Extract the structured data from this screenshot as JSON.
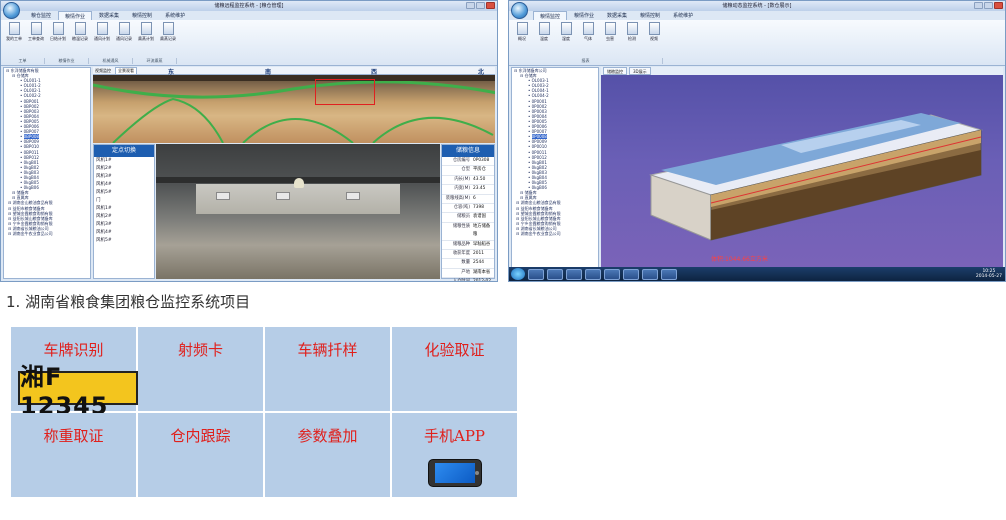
{
  "window1": {
    "title": "储粮远程监控系统 - [粮仓管理]",
    "tabs": [
      "粮仓监控",
      "粮情作业",
      "数据采集",
      "粮情控制",
      "系统维护"
    ],
    "active_tab": 1,
    "ribbon_buttons": [
      "我的工单",
      "工单查询",
      "日结计划",
      "粮温记录",
      "通风计划",
      "通风记录",
      "熏蒸计划",
      "熏蒸记录"
    ],
    "ribbon_groups": [
      "工单",
      "粮情作业",
      "机械通风",
      "环流熏蒸"
    ],
    "tree_items": [
      "东洋储备库有限",
      "仓储库",
      "OL001-1",
      "OL001-2",
      "OL002-1",
      "OL002-2",
      "0BP001",
      "0BP002",
      "0BP003",
      "0BP004",
      "0BP005",
      "0BP006",
      "0BP007",
      "0BP008",
      "0BP009",
      "0BP010",
      "0BP011",
      "0BP012",
      "0kgB01",
      "0kgB02",
      "0kgB03",
      "0kgB04",
      "0kgB05",
      "0kgB06",
      "储备库",
      "直属库",
      "湖南金山粮油食品有限",
      "益阳市粮食储备库",
      "望城金霞粮食购销有限",
      "益阳长城山粮食储备库",
      "宁乡金霞粮食购销有限",
      "湖南省长城粮油公司",
      "湖南金牛农业食品公司"
    ],
    "selected_tree_index": 13,
    "directions": [
      "东",
      "南",
      "西",
      "北"
    ],
    "header_dropdown": "全景观看",
    "side_list_title": "定点切换",
    "side_list": [
      "风机1#",
      "风机2#",
      "风机3#",
      "风机4#",
      "风机5#",
      "门",
      "风机1#",
      "风机2#",
      "风机3#",
      "风机4#",
      "风机5#"
    ],
    "info_title": "储粮信息",
    "info_rows": [
      {
        "k": "仓房编号",
        "v": "0P0308"
      },
      {
        "k": "仓型",
        "v": "平房仓"
      },
      {
        "k": "内长(M)",
        "v": "43.50"
      },
      {
        "k": "内宽(M)",
        "v": "23.45"
      },
      {
        "k": "装粮线高(M)",
        "v": "6"
      },
      {
        "k": "仓容(吨)",
        "v": "7398"
      },
      {
        "k": "储粮员",
        "v": "袁谱国"
      },
      {
        "k": "储粮性质",
        "v": "地方储备粮"
      },
      {
        "k": "储粮品种",
        "v": "早籼稻谷"
      },
      {
        "k": "收获年度",
        "v": "2011"
      },
      {
        "k": "数量",
        "v": "2544"
      },
      {
        "k": "产地",
        "v": "湖南本省"
      },
      {
        "k": "入仓时间",
        "v": "2012-02"
      },
      {
        "k": "保管方式",
        "v": "散装"
      }
    ]
  },
  "window2": {
    "title": "储粮动态监控系统 - [数仓展示]",
    "tabs": [
      "粮情监控",
      "粮情作业",
      "数据采集",
      "粮情控制",
      "系统维护"
    ],
    "active_tab": 0,
    "ribbon_buttons": [
      "概况",
      "温度",
      "湿度",
      "气体",
      "虫害",
      "检测",
      "视频"
    ],
    "ribbon_groups": [
      "报表"
    ],
    "view_tabs": [
      "储粮监控",
      "3D展示"
    ],
    "tree_items": [
      "东洋储备库公司",
      "仓储库",
      "OL003-1",
      "OL003-2",
      "OL004-1",
      "OL004-2",
      "0P0001",
      "0P0002",
      "0P0003",
      "0P0004",
      "0P0005",
      "0P0006",
      "0P0007",
      "0P0008",
      "0P0009",
      "0P0010",
      "0P0011",
      "0P0012",
      "0kgB01",
      "0kgB02",
      "0kgB03",
      "0kgB04",
      "0kgB05",
      "0kgB06",
      "储备库",
      "直属库",
      "湖南金山粮油食品有限",
      "益阳市粮食储备库",
      "望城金霞粮食购销有限",
      "益阳长城山粮食储备库",
      "宁乡金霞粮食购销有限",
      "湖南省长城粮油公司",
      "湖南金牛农业食品公司"
    ],
    "selected_tree_index": 13,
    "volume_text": "体积:1044.66立方米",
    "clock_time": "10:25",
    "clock_date": "2014-05-27"
  },
  "caption": "1. 湖南省粮食集团粮仓监控系统项目",
  "features": [
    {
      "label": "车牌识别",
      "extra": "plate"
    },
    {
      "label": "射频卡"
    },
    {
      "label": "车辆扦样"
    },
    {
      "label": "化验取证"
    },
    {
      "label": "称重取证"
    },
    {
      "label": "仓内跟踪"
    },
    {
      "label": "参数叠加"
    },
    {
      "label": "手机APP",
      "extra": "phone"
    }
  ],
  "plate_text": "湘F 12345",
  "colors": {
    "grid_cell": "#b6cde7",
    "feature_text": "#e0201c",
    "plate_bg": "#f3c51e",
    "panel_header": "#1e5eb0"
  }
}
